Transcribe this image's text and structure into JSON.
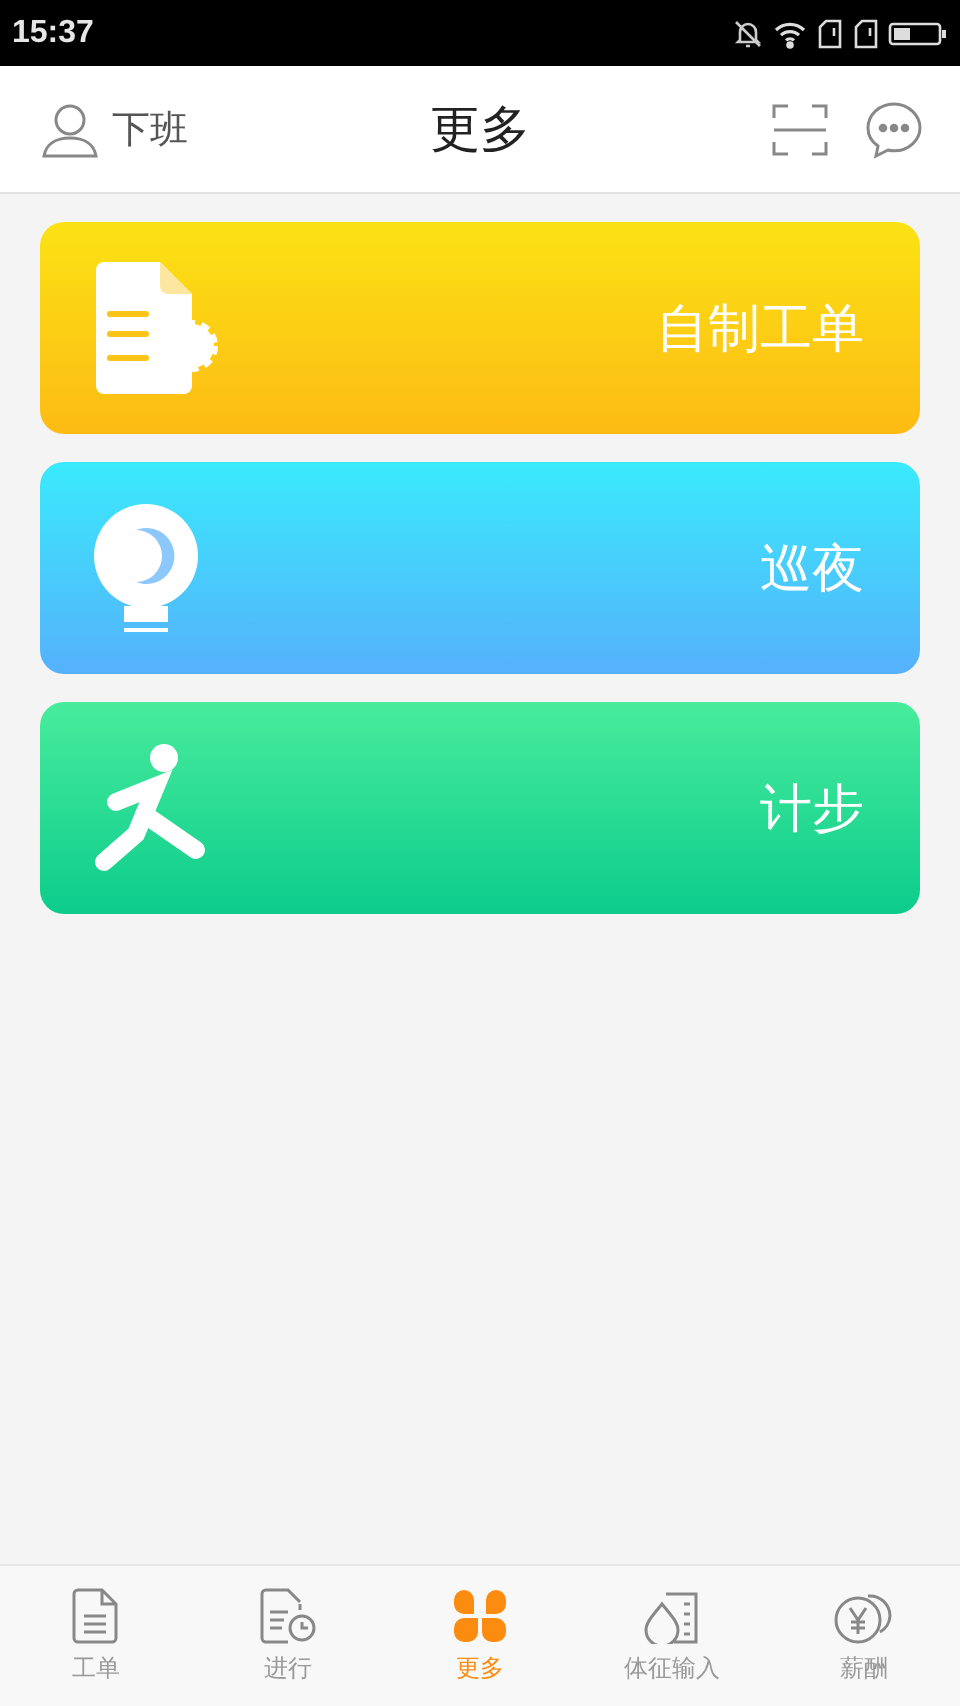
{
  "status_bar": {
    "time": "15:37"
  },
  "header": {
    "user_label": "下班",
    "title": "更多"
  },
  "cards": [
    {
      "kind": "workorder",
      "label": "自制工单"
    },
    {
      "kind": "night",
      "label": "巡夜"
    },
    {
      "kind": "steps",
      "label": "计步"
    }
  ],
  "tab_bar": [
    {
      "kind": "doc",
      "label": "工单",
      "selected": false
    },
    {
      "kind": "progress",
      "label": "进行",
      "selected": false
    },
    {
      "kind": "more",
      "label": "更多",
      "selected": true
    },
    {
      "kind": "vitals",
      "label": "体征输入",
      "selected": false
    },
    {
      "kind": "salary",
      "label": "薪酬",
      "selected": false
    }
  ]
}
